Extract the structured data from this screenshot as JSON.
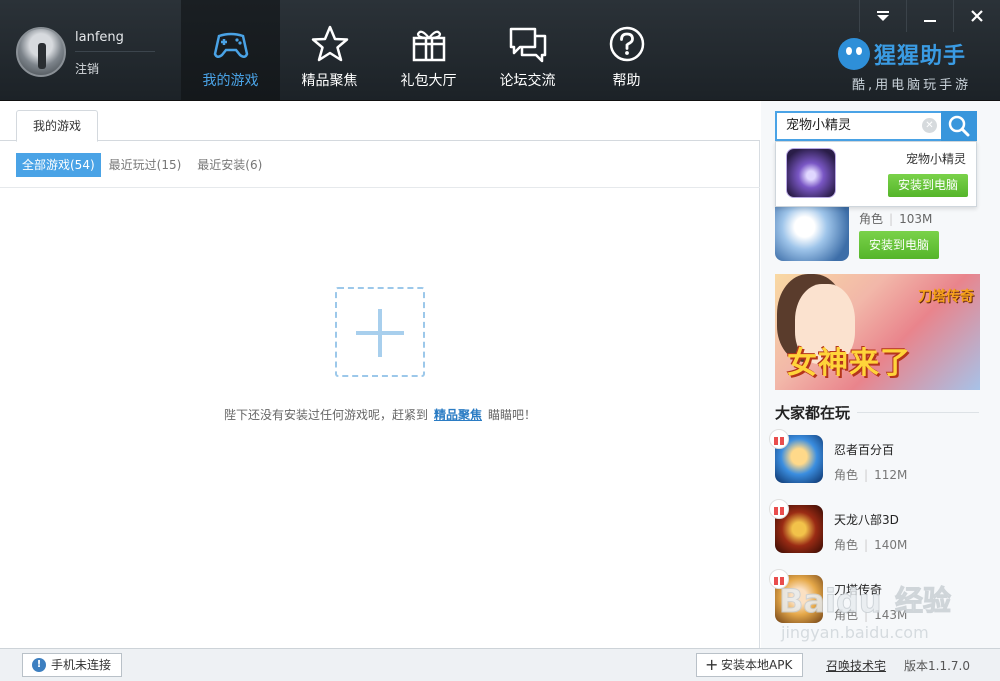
{
  "user": {
    "name": "lanfeng",
    "logout": "注销"
  },
  "nav": [
    {
      "label": "我的游戏",
      "icon": "gamepad-icon",
      "active": true
    },
    {
      "label": "精品聚焦",
      "icon": "star-icon",
      "active": false
    },
    {
      "label": "礼包大厅",
      "icon": "gift-icon",
      "active": false
    },
    {
      "label": "论坛交流",
      "icon": "chat-icon",
      "active": false
    },
    {
      "label": "帮助",
      "icon": "help-icon",
      "active": false
    }
  ],
  "brand": {
    "name": "猩猩助手",
    "slogan": "酷,用电脑玩手游"
  },
  "window_controls": [
    "dropdown-icon",
    "minimize-icon",
    "close-icon"
  ],
  "main": {
    "tab": "我的游戏",
    "filters": [
      {
        "label": "全部游戏(54)",
        "active": true
      },
      {
        "label": "最近玩过(15)",
        "active": false
      },
      {
        "label": "最近安装(6)",
        "active": false
      }
    ],
    "empty": {
      "before": "陛下还没有安装过任何游戏呢，赶紧到",
      "link": "精品聚焦",
      "after": "瞄瞄吧！"
    }
  },
  "side": {
    "search": {
      "value": "宠物小精灵"
    },
    "suggestion": {
      "name": "宠物小精灵",
      "install": "安装到电脑"
    },
    "featured": {
      "genre": "角色",
      "size": "103M",
      "install": "安装到电脑"
    },
    "banner": {
      "title": "女神来了",
      "logo": "刀塔传奇"
    },
    "section_title": "大家都在玩",
    "games": [
      {
        "name": "忍者百分百",
        "genre": "角色",
        "size": "112M"
      },
      {
        "name": "天龙八部3D",
        "genre": "角色",
        "size": "140M"
      },
      {
        "name": "刀塔传奇",
        "genre": "角色",
        "size": "143M"
      }
    ],
    "watermark": {
      "brand": "Baidu",
      "text": "经验",
      "url": "jingyan.baidu.com"
    }
  },
  "status": {
    "phone": "手机未连接",
    "apk": "安装本地APK",
    "support": "召唤技术宅",
    "version": "版本1.1.7.0"
  },
  "colors": {
    "accent": "#4aa3e6",
    "header_bg": "#20272c",
    "install_green": "#5dbb31"
  }
}
